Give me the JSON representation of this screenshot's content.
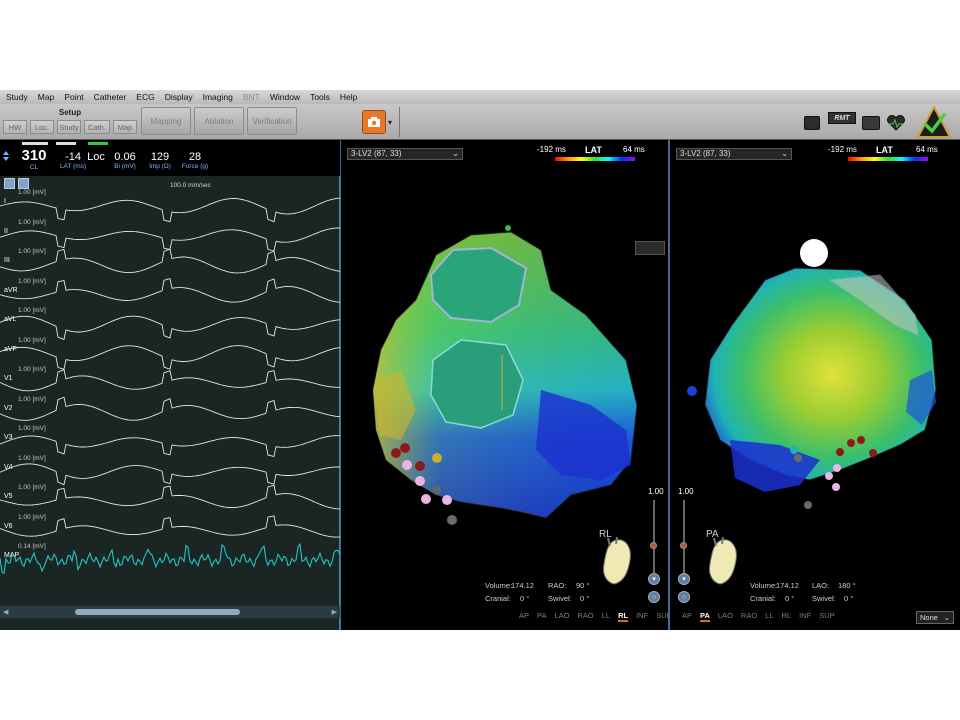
{
  "menu": [
    "Study",
    "Map",
    "Point",
    "Catheter",
    "ECG",
    "Display",
    "Imaging",
    "BNT",
    "Window",
    "Tools",
    "Help"
  ],
  "toolbar": {
    "setup_label": "Setup",
    "small_buttons": [
      "HW",
      "Loc.",
      "Study",
      "Cath.",
      "Map"
    ],
    "big_buttons": [
      "Mapping",
      "Ablation",
      "Verification"
    ],
    "rmt_label": "RMT"
  },
  "header": {
    "cl_value": "310",
    "cl_label": "CL",
    "lat_value": "-14",
    "lat_label": "LAT (ms)",
    "loc_value": "Loc",
    "bi_value": "0.06",
    "bi_label": "Bi (mV)",
    "imp_value": "129",
    "imp_label": "Imp (Ω)",
    "force_value": "28",
    "force_label": "Force (g)"
  },
  "ecg": {
    "speed": "100.0 mm/sec",
    "unit": "[mV]",
    "channels": [
      {
        "name": "I",
        "scale": "1.00"
      },
      {
        "name": "II",
        "scale": "1.00"
      },
      {
        "name": "III",
        "scale": "1.00"
      },
      {
        "name": "aVR",
        "scale": "1.00"
      },
      {
        "name": "aVL",
        "scale": "1.00"
      },
      {
        "name": "aVF",
        "scale": "1.00"
      },
      {
        "name": "V1",
        "scale": "1.00"
      },
      {
        "name": "V2",
        "scale": "1.00"
      },
      {
        "name": "V3",
        "scale": "1.00"
      },
      {
        "name": "V4",
        "scale": "1.00"
      },
      {
        "name": "V5",
        "scale": "1.00"
      },
      {
        "name": "V6",
        "scale": "1.00"
      },
      {
        "name": "MAP",
        "scale": "0.14"
      }
    ]
  },
  "view_left": {
    "map_name": "3-LV2 (87, 33)",
    "lat_min": "-192 ms",
    "lat_title": "LAT",
    "lat_max": "64 ms",
    "zoom": "1.00",
    "orientation": "RL",
    "volume_label": "Volume:",
    "volume_value": "174.12",
    "proj_label": "RAO:",
    "proj_value": "90 °",
    "cranial_label": "Cranial:",
    "cranial_value": "0 °",
    "swivel_label": "Swivel:",
    "swivel_value": "0 °",
    "views": [
      "AP",
      "PA",
      "LAO",
      "RAO",
      "LL",
      "RL",
      "INF",
      "SUP"
    ],
    "selected_view": "RL"
  },
  "view_right": {
    "map_name": "3-LV2 (87, 33)",
    "lat_min": "-192 ms",
    "lat_title": "LAT",
    "lat_max": "64 ms",
    "zoom": "1.00",
    "orientation": "PA",
    "volume_label": "Volume:",
    "volume_value": "174.12",
    "proj_label": "LAO:",
    "proj_value": "180 °",
    "cranial_label": "Cranial:",
    "cranial_value": "0 °",
    "swivel_label": "Swivel:",
    "swivel_value": "0 °",
    "views": [
      "AP",
      "PA",
      "LAO",
      "RAO",
      "LL",
      "RL",
      "INF",
      "SUP"
    ],
    "selected_view": "PA",
    "overlay_select": "None"
  },
  "colors": {
    "accent": "#d86a1c",
    "ecg_trace": "#e6e6e6",
    "map_trace": "#1fc7c7",
    "panel_bg": "#1b2523"
  }
}
